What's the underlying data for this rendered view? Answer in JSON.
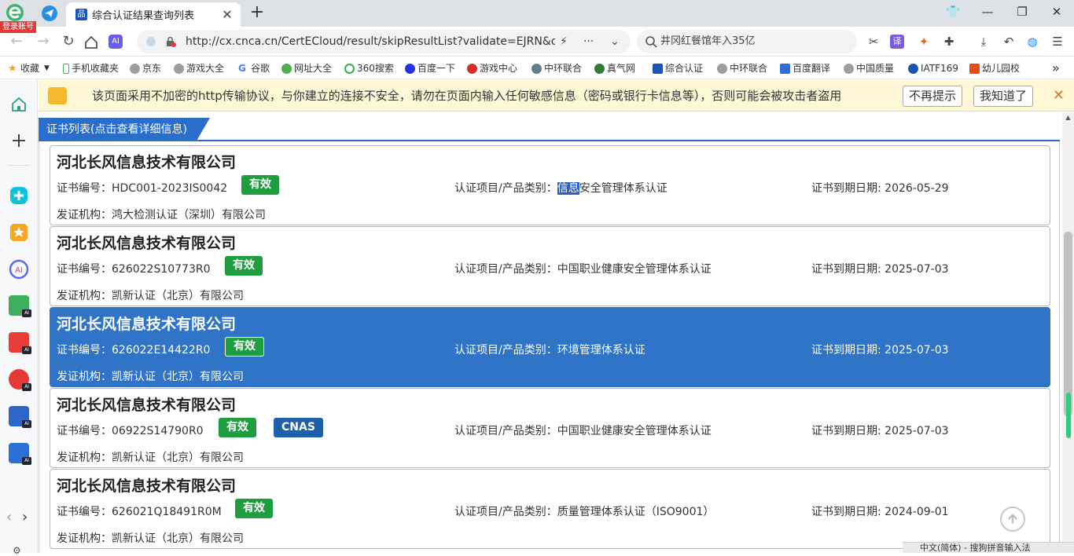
{
  "browser": {
    "login_badge": "登录账号",
    "tab_title": "综合认证结果查询列表",
    "new_tab_symbol": "+",
    "url": "http://cx.cnca.cn/CertECloud/result/skipResultList?validate=EJRN&cer",
    "search_text": "井冈红餐馆年入35亿",
    "icons": [
      "ie-logo-icon",
      "telegram-icon",
      "back-icon",
      "forward-icon",
      "reload-icon",
      "home-icon",
      "ai-icon",
      "lock-icon",
      "lightning-icon",
      "more-icon",
      "chevron-down-icon",
      "search-icon",
      "cut-icon",
      "translate-icon",
      "fox-icon",
      "extensions-icon",
      "download-icon",
      "undo-icon",
      "edge-icon",
      "menu-icon"
    ]
  },
  "bookmarks": [
    {
      "label": "收藏",
      "color": "#f5a623"
    },
    {
      "label": "手机收藏夹",
      "color": "#4caf50"
    },
    {
      "label": "京东",
      "color": "#9e9e9e"
    },
    {
      "label": "游戏大全",
      "color": "#9e9e9e"
    },
    {
      "label": "谷歌",
      "color": "#4285f4"
    },
    {
      "label": "网址大全",
      "color": "#4caf50"
    },
    {
      "label": "360搜索",
      "color": "#2fb344"
    },
    {
      "label": "百度一下",
      "color": "#2932e1"
    },
    {
      "label": "游戏中心",
      "color": "#d32f2f"
    },
    {
      "label": "中环联合",
      "color": "#607d8b"
    },
    {
      "label": "真气网",
      "color": "#2e7d32"
    },
    {
      "label": "综合认证",
      "color": "#1a56b0"
    },
    {
      "label": "中环联合",
      "color": "#9e9e9e"
    },
    {
      "label": "百度翻译",
      "color": "#2f6fd0"
    },
    {
      "label": "中国质量",
      "color": "#9e9e9e"
    },
    {
      "label": "IATF169",
      "color": "#1a56b0"
    },
    {
      "label": "幼儿园校",
      "color": "#e64a19"
    }
  ],
  "bookmarks_more": "»",
  "warning": {
    "message": "该页面采用不加密的http传输协议，与你建立的连接不安全，请勿在页面内输入任何敏感信息（密码或银行卡信息等），否则可能会被攻击者盗用",
    "btn_dont_remind": "不再提示",
    "btn_got_it": "我知道了",
    "close": "✕"
  },
  "panel": {
    "title": "证书列表(点击查看详细信息)"
  },
  "labels": {
    "cert_no": "证书编号：",
    "project": "认证项目/产品类别：",
    "expiry": "证书到期日期: ",
    "issuer": "发证机构："
  },
  "certs": [
    {
      "company": "河北长风信息技术有限公司",
      "cert_no": "HDC001-2023IS0042",
      "status": "有效",
      "project_hl": "信息",
      "project": "安全管理体系认证",
      "expiry": "2026-05-29",
      "issuer": "鸿大检测认证（深圳）有限公司",
      "cnas": ""
    },
    {
      "company": "河北长风信息技术有限公司",
      "cert_no": "626022S10773R0",
      "status": "有效",
      "project_hl": "",
      "project": "中国职业健康安全管理体系认证",
      "expiry": "2025-07-03",
      "issuer": "凯新认证（北京）有限公司",
      "cnas": ""
    },
    {
      "company": "河北长风信息技术有限公司",
      "cert_no": "626022E14422R0",
      "status": "有效",
      "project_hl": "",
      "project": "环境管理体系认证",
      "expiry": "2025-07-03",
      "issuer": "凯新认证（北京）有限公司",
      "cnas": ""
    },
    {
      "company": "河北长风信息技术有限公司",
      "cert_no": "06922S14790R0",
      "status": "有效",
      "project_hl": "",
      "project": "中国职业健康安全管理体系认证",
      "expiry": "2025-07-03",
      "issuer": "凯新认证（北京）有限公司",
      "cnas": "CNAS"
    },
    {
      "company": "河北长风信息技术有限公司",
      "cert_no": "626021Q18491R0M",
      "status": "有效",
      "project_hl": "",
      "project": "质量管理体系认证（ISO9001）",
      "expiry": "2024-09-01",
      "issuer": "凯新认证（北京）有限公司",
      "cnas": ""
    }
  ],
  "ime_text": "中文(简体) - 搜狗拼音输入法"
}
